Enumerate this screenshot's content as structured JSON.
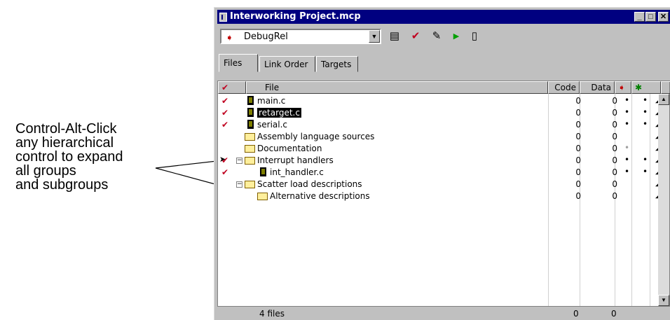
{
  "callout": {
    "lines": [
      "Control-Alt-Click",
      "any hierarchical",
      "control to expand",
      "all groups",
      "and subgroups"
    ]
  },
  "window": {
    "title": "Interworking Project.mcp",
    "controls": {
      "minimize": "_",
      "maximize": "□",
      "close": "✕"
    }
  },
  "toolbar": {
    "target": "DebugRel",
    "icons": [
      "target-settings-icon",
      "check-syntax-icon",
      "make-icon",
      "run-icon",
      "project-inspector-icon"
    ]
  },
  "tabs": [
    "Files",
    "Link Order",
    "Targets"
  ],
  "columns": {
    "check": "✔",
    "file": "File",
    "code": "Code",
    "data": "Data",
    "debug": "debug-icon",
    "target": "target-icon"
  },
  "files": [
    {
      "name": "main.c",
      "code": "0",
      "data": "0",
      "debug": "•",
      "target": "•",
      "check": true,
      "kind": "file",
      "indent": 0,
      "selected": false
    },
    {
      "name": "retarget.c",
      "code": "0",
      "data": "0",
      "debug": "•",
      "target": "•",
      "check": true,
      "kind": "file",
      "indent": 0,
      "selected": true
    },
    {
      "name": "serial.c",
      "code": "0",
      "data": "0",
      "debug": "•",
      "target": "•",
      "check": true,
      "kind": "file",
      "indent": 0,
      "selected": false
    },
    {
      "name": "Assembly language sources",
      "code": "0",
      "data": "0",
      "debug": "",
      "target": "",
      "check": false,
      "kind": "folder",
      "indent": 0,
      "selected": false
    },
    {
      "name": "Documentation",
      "code": "0",
      "data": "0",
      "debug": "•",
      "debug_grey": true,
      "target": "",
      "check": false,
      "kind": "folder",
      "indent": 0,
      "selected": false
    },
    {
      "name": "Interrupt handlers",
      "code": "0",
      "data": "0",
      "debug": "•",
      "target": "•",
      "check": true,
      "arrow": true,
      "kind": "folder-open",
      "indent": 0,
      "expander": "−",
      "selected": false
    },
    {
      "name": "int_handler.c",
      "code": "0",
      "data": "0",
      "debug": "•",
      "target": "•",
      "check": true,
      "kind": "file",
      "indent": 1,
      "selected": false
    },
    {
      "name": "Scatter load descriptions",
      "code": "0",
      "data": "0",
      "debug": "",
      "target": "",
      "check": false,
      "kind": "folder-open",
      "indent": 0,
      "expander": "−",
      "selected": false
    },
    {
      "name": "Alternative descriptions",
      "code": "0",
      "data": "0",
      "debug": "",
      "target": "",
      "check": false,
      "kind": "folder",
      "indent": 1,
      "selected": false
    }
  ],
  "status": {
    "count": "4 files",
    "code": "0",
    "data": "0"
  }
}
